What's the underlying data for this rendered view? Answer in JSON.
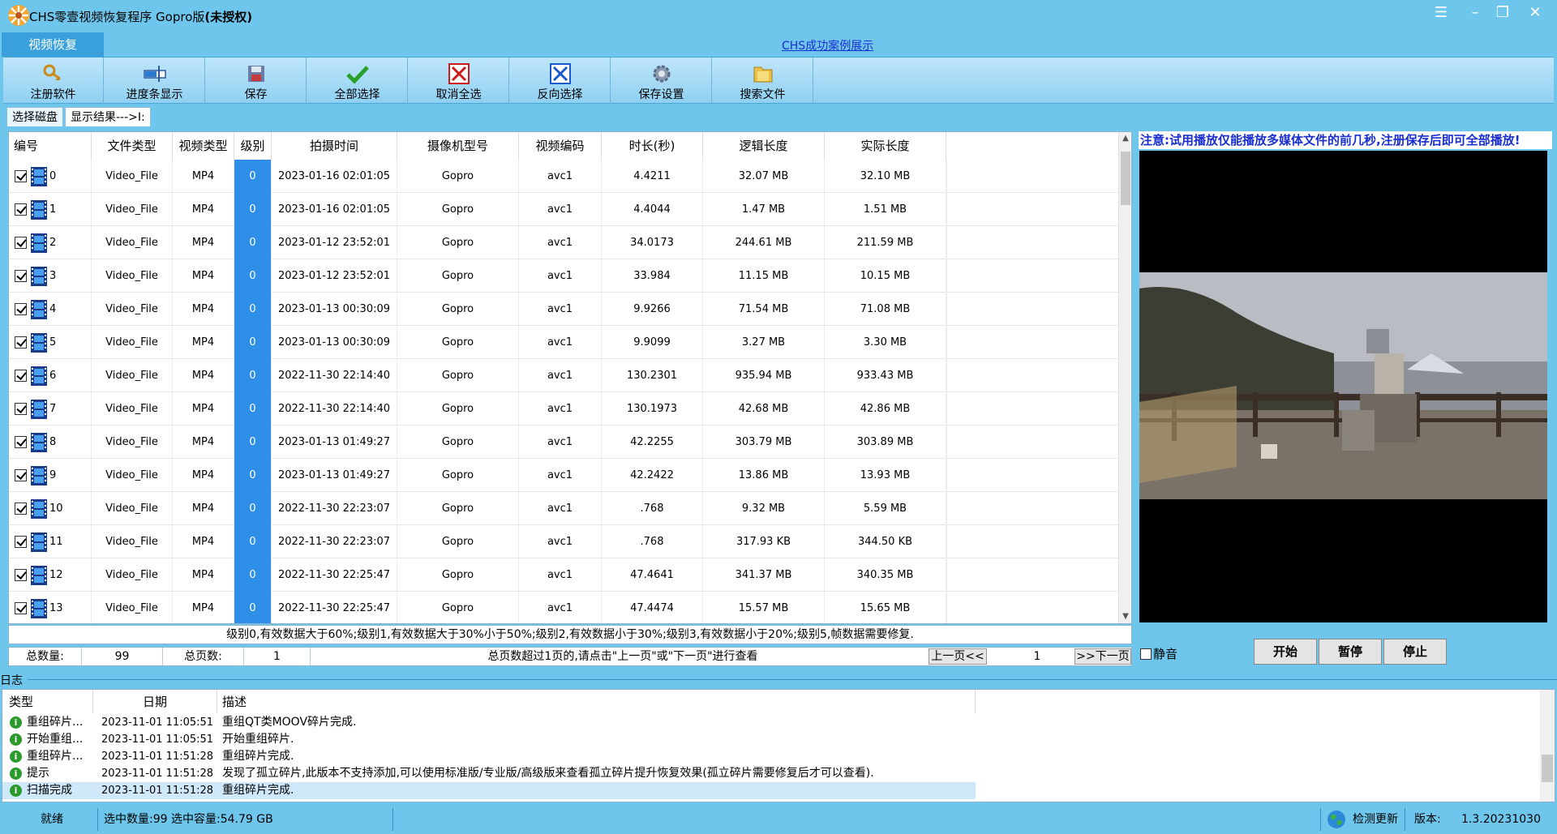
{
  "window": {
    "title_prefix": "CHS零壹视频恢复程序 Gopro版",
    "title_suffix": "(未授权)"
  },
  "main_tab": "视频恢复",
  "success_link": "CHS成功案例展示",
  "toolbar": [
    {
      "label": "注册软件",
      "icon": "key-icon"
    },
    {
      "label": "进度条显示",
      "icon": "progress-icon"
    },
    {
      "label": "保存",
      "icon": "save-icon"
    },
    {
      "label": "全部选择",
      "icon": "check-icon"
    },
    {
      "label": "取消全选",
      "icon": "uncheck-icon"
    },
    {
      "label": "反向选择",
      "icon": "invert-icon"
    },
    {
      "label": "保存设置",
      "icon": "settings-icon"
    },
    {
      "label": "搜索文件",
      "icon": "folder-search-icon"
    }
  ],
  "subtabs": [
    "选择磁盘",
    "显示结果--->I:"
  ],
  "table": {
    "columns": [
      "编号",
      "文件类型",
      "视频类型",
      "级别",
      "拍摄时间",
      "摄像机型号",
      "视频编码",
      "时长(秒)",
      "逻辑长度",
      "实际长度"
    ],
    "rows": [
      {
        "id": "0",
        "ftype": "Video_File",
        "vtype": "MP4",
        "level": "0",
        "time": "2023-01-16 02:01:05",
        "camera": "Gopro",
        "codec": "avc1",
        "duration": "4.4211",
        "logical": "32.07 MB",
        "actual": "32.10 MB"
      },
      {
        "id": "1",
        "ftype": "Video_File",
        "vtype": "MP4",
        "level": "0",
        "time": "2023-01-16 02:01:05",
        "camera": "Gopro",
        "codec": "avc1",
        "duration": "4.4044",
        "logical": "1.47 MB",
        "actual": "1.51 MB"
      },
      {
        "id": "2",
        "ftype": "Video_File",
        "vtype": "MP4",
        "level": "0",
        "time": "2023-01-12 23:52:01",
        "camera": "Gopro",
        "codec": "avc1",
        "duration": "34.0173",
        "logical": "244.61 MB",
        "actual": "211.59 MB"
      },
      {
        "id": "3",
        "ftype": "Video_File",
        "vtype": "MP4",
        "level": "0",
        "time": "2023-01-12 23:52:01",
        "camera": "Gopro",
        "codec": "avc1",
        "duration": "33.984",
        "logical": "11.15 MB",
        "actual": "10.15 MB"
      },
      {
        "id": "4",
        "ftype": "Video_File",
        "vtype": "MP4",
        "level": "0",
        "time": "2023-01-13 00:30:09",
        "camera": "Gopro",
        "codec": "avc1",
        "duration": "9.9266",
        "logical": "71.54 MB",
        "actual": "71.08 MB"
      },
      {
        "id": "5",
        "ftype": "Video_File",
        "vtype": "MP4",
        "level": "0",
        "time": "2023-01-13 00:30:09",
        "camera": "Gopro",
        "codec": "avc1",
        "duration": "9.9099",
        "logical": "3.27 MB",
        "actual": "3.30 MB"
      },
      {
        "id": "6",
        "ftype": "Video_File",
        "vtype": "MP4",
        "level": "0",
        "time": "2022-11-30 22:14:40",
        "camera": "Gopro",
        "codec": "avc1",
        "duration": "130.2301",
        "logical": "935.94 MB",
        "actual": "933.43 MB"
      },
      {
        "id": "7",
        "ftype": "Video_File",
        "vtype": "MP4",
        "level": "0",
        "time": "2022-11-30 22:14:40",
        "camera": "Gopro",
        "codec": "avc1",
        "duration": "130.1973",
        "logical": "42.68 MB",
        "actual": "42.86 MB"
      },
      {
        "id": "8",
        "ftype": "Video_File",
        "vtype": "MP4",
        "level": "0",
        "time": "2023-01-13 01:49:27",
        "camera": "Gopro",
        "codec": "avc1",
        "duration": "42.2255",
        "logical": "303.79 MB",
        "actual": "303.89 MB"
      },
      {
        "id": "9",
        "ftype": "Video_File",
        "vtype": "MP4",
        "level": "0",
        "time": "2023-01-13 01:49:27",
        "camera": "Gopro",
        "codec": "avc1",
        "duration": "42.2422",
        "logical": "13.86 MB",
        "actual": "13.93 MB"
      },
      {
        "id": "10",
        "ftype": "Video_File",
        "vtype": "MP4",
        "level": "0",
        "time": "2022-11-30 22:23:07",
        "camera": "Gopro",
        "codec": "avc1",
        "duration": ".768",
        "logical": "9.32 MB",
        "actual": "5.59 MB"
      },
      {
        "id": "11",
        "ftype": "Video_File",
        "vtype": "MP4",
        "level": "0",
        "time": "2022-11-30 22:23:07",
        "camera": "Gopro",
        "codec": "avc1",
        "duration": ".768",
        "logical": "317.93 KB",
        "actual": "344.50 KB"
      },
      {
        "id": "12",
        "ftype": "Video_File",
        "vtype": "MP4",
        "level": "0",
        "time": "2022-11-30 22:25:47",
        "camera": "Gopro",
        "codec": "avc1",
        "duration": "47.4641",
        "logical": "341.37 MB",
        "actual": "340.35 MB"
      },
      {
        "id": "13",
        "ftype": "Video_File",
        "vtype": "MP4",
        "level": "0",
        "time": "2022-11-30 22:25:47",
        "camera": "Gopro",
        "codec": "avc1",
        "duration": "47.4474",
        "logical": "15.57 MB",
        "actual": "15.65 MB"
      }
    ]
  },
  "level_legend": "级别0,有效数据大于60%;级别1,有效数据大于30%小于50%;级别2,有效数据小于30%;级别3,有效数据小于20%;级别5,帧数据需要修复.",
  "pagination": {
    "total_label": "总数量:",
    "total_value": "99",
    "pages_label": "总页数:",
    "pages_value": "1",
    "hint": "总页数超过1页的,请点击\"上一页\"或\"下一页\"进行查看",
    "prev": "上一页<<",
    "current": "1",
    "next": ">>下一页"
  },
  "preview": {
    "notice": "注意:试用播放仅能播放多媒体文件的前几秒,注册保存后即可全部播放!",
    "mute": "静音",
    "start": "开始",
    "pause": "暂停",
    "stop": "停止"
  },
  "log": {
    "label": "日志",
    "columns": [
      "类型",
      "日期",
      "描述"
    ],
    "rows": [
      {
        "type": "重组碎片...",
        "date": "2023-11-01 11:05:51",
        "desc": "重组QT类MOOV碎片完成."
      },
      {
        "type": "开始重组...",
        "date": "2023-11-01 11:05:51",
        "desc": "开始重组碎片."
      },
      {
        "type": "重组碎片...",
        "date": "2023-11-01 11:51:28",
        "desc": "重组碎片完成."
      },
      {
        "type": "提示",
        "date": "2023-11-01 11:51:28",
        "desc": "发现了孤立碎片,此版本不支持添加,可以使用标准版/专业版/高级版来查看孤立碎片提升恢复效果(孤立碎片需要修复后才可以查看)."
      },
      {
        "type": "扫描完成",
        "date": "2023-11-01 11:51:28",
        "desc": "重组碎片完成."
      }
    ]
  },
  "status": {
    "ready": "就绪",
    "selection": "选中数量:99 选中容量:54.79 GB",
    "update": "检测更新",
    "version_label": "版本:",
    "version": "1.3.20231030"
  },
  "colors": {
    "chrome": "#6ec6ec",
    "level_cell": "#2f8fe8",
    "notice_text": "#1a2fd0"
  }
}
